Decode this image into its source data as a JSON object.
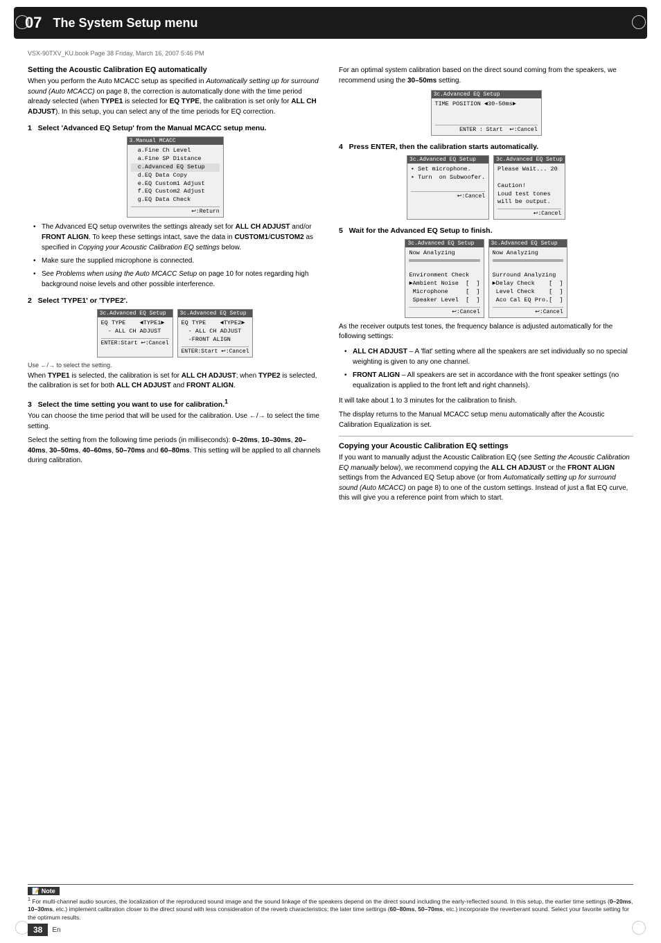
{
  "header": {
    "chapter": "07",
    "title": "The System Setup menu"
  },
  "filepath": "VSX-90TXV_KU.book  Page 38  Friday, March 16, 2007  5:46 PM",
  "page_number": "38",
  "page_lang": "En",
  "left_col": {
    "section_heading": "Setting the Acoustic Calibration EQ automatically",
    "section_intro": "When you perform the Auto MCACC setup as specified in Automatically setting up for surround sound (Auto MCACC) on page 8, the correction is automatically done with the time period already selected (when TYPE1 is selected for EQ TYPE, the calibration is set only for ALL CH ADJUST). In this setup, you can select any of the time periods for EQ correction.",
    "step1": {
      "heading": "1   Select 'Advanced EQ Setup' from the Manual MCACC setup menu.",
      "screen": {
        "title": "3.Manual MCACC",
        "lines": [
          "  a.Fine Ch Level",
          "  a.Fine SP Distance",
          "  c.Advanced EQ Setup",
          "  d.EQ Data Copy",
          "  e.EQ Custom1 Adjust",
          "  f.EQ Custom2 Adjust",
          "  g.EQ Data Check"
        ],
        "footer": "↩:Return"
      },
      "bullets": [
        "The Advanced EQ setup overwrites the settings already set for ALL CH ADJUST and/or FRONT ALIGN. To keep these settings intact, save the data in CUSTOM1/CUSTOM2 as specified in Copying your Acoustic Calibration EQ settings below.",
        "Make sure the supplied microphone is connected.",
        "See Problems when using the Auto MCACC Setup on page 10 for notes regarding high background noise levels and other possible interference."
      ]
    },
    "step2": {
      "heading": "2   Select 'TYPE1' or 'TYPE2'.",
      "screens_left": {
        "title": "3c.Advanced EQ Setup",
        "lines": [
          "EQ TYPE      ◄TYPE1►",
          "  - ALL CH ADJUST"
        ],
        "footer": "ENTER : Start  ↩:Cancel"
      },
      "screens_right": {
        "title": "3c.Advanced EQ Setup",
        "lines": [
          "EQ TYPE      ◄TYPE2►",
          "  - ALL CH ADJUST",
          "  -FRONT ALIGN"
        ],
        "footer": "ENTER : Start  ↩:Cancel"
      },
      "use_note": "Use ←/→ to select the setting.",
      "description": "When TYPE1 is selected, the calibration is set for ALL CH ADJUST; when TYPE2 is selected, the calibration is set for both ALL CH ADJUST and FRONT ALIGN."
    },
    "step3": {
      "heading": "3   Select the time setting you want to use for calibration.",
      "superscript": "1",
      "text1": "You can choose the time period that will be used for the calibration. Use ←/→ to select the time setting.",
      "text2": "Select the setting from the following time periods (in milliseconds): 0–20ms, 10–30ms, 20–40ms, 30–50ms, 40–60ms, 50–70ms and 60–80ms. This setting will be applied to all channels during calibration."
    }
  },
  "right_col": {
    "step3_screen": {
      "title": "3c.Advanced EQ Setup",
      "line": "TIME POSITION  ◄30-50ms►",
      "footer_enter": "ENTER : Start",
      "footer_cancel": "↩:Cancel"
    },
    "step3_note": "For an optimal system calibration based on the direct sound coming from the speakers, we recommend using the 30–50ms setting.",
    "step4": {
      "heading": "4   Press ENTER, then the calibration starts automatically.",
      "screen_left": {
        "title": "3c.Advanced EQ Setup",
        "lines": [
          "• Set microphone.",
          "• Turn  on Subwoofer."
        ],
        "footer": "↩:Cancel"
      },
      "screen_right": {
        "title": "3c.Advanced EQ Setup",
        "lines": [
          "Please Wait... 20",
          "",
          "Caution!",
          "Loud test tones",
          "will be output."
        ],
        "footer": "↩:Cancel"
      }
    },
    "step5": {
      "heading": "5   Wait for the Advanced EQ Setup to finish.",
      "screen_left": {
        "title": "3c.Advanced EQ Setup",
        "lines": [
          "Now Analyzing",
          "▬▬▬▬▬▬▬▬▬▬",
          "",
          "Environment Check",
          "►Ambient Noise   [    ]",
          " Microphone      [    ]",
          " Speaker Level   [    ]"
        ],
        "footer": "↩:Cancel"
      },
      "screen_right": {
        "title": "3c.Advanced EQ Setup",
        "lines": [
          "Now Analyzing",
          "▬▬▬▬▬▬▬▬▬▬",
          "",
          "Surround Analyzing",
          "►Delay Check     [    ]",
          " Level Check     [    ]",
          " Aco Cal EQ Pro. [    ]"
        ],
        "footer": "↩:Cancel"
      }
    },
    "after_step5": {
      "intro": "As the receiver outputs test tones, the frequency balance is adjusted automatically for the following settings:",
      "bullets": [
        {
          "label": "ALL CH ADJUST",
          "text": "– A 'flat' setting where all the speakers are set individually so no special weighting is given to any one channel."
        },
        {
          "label": "FRONT ALIGN",
          "text": "– All speakers are set in accordance with the front speaker settings (no equalization is applied to the front left and right channels)."
        }
      ],
      "timing_note": "It will take about 1 to 3 minutes for the calibration to finish.",
      "return_note": "The display returns to the Manual MCACC setup menu automatically after the Acoustic Calibration Equalization is set.",
      "copy_heading": "Copying your Acoustic Calibration EQ settings",
      "copy_text": "If you want to manually adjust the Acoustic Calibration EQ (see Setting the Acoustic Calibration EQ manually below), we recommend copying the ALL CH ADJUST or the FRONT ALIGN settings from the Advanced EQ Setup above (or from Automatically setting up for surround sound (Auto MCACC) on page 8) to one of the custom settings. Instead of just a flat EQ curve, this will give you a reference point from which to start."
    }
  },
  "note": {
    "title": "Note",
    "number": "1",
    "text": "For multi-channel audio sources, the localization of the reproduced sound image and the sound linkage of the speakers depend on the direct sound including the early-reflected sound. In this setup, the earlier time settings (0–20ms, 10–30ms, etc.) implement calibration closer to the direct sound with less consideration of the reverb characteristics; the later time settings (60–80ms, 50–70ms, etc.) incorporate the reverberant sound. Select your favorite setting for the optimum results."
  }
}
